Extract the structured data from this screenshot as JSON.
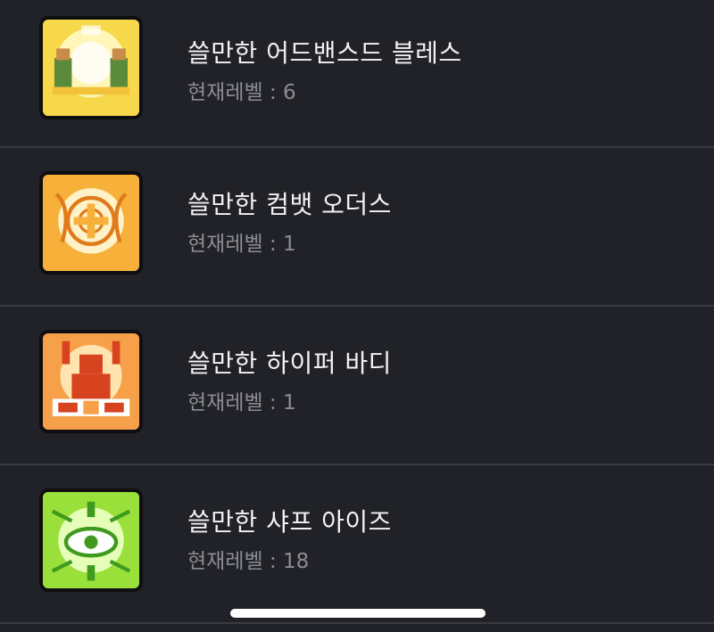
{
  "skills": [
    {
      "name": "쓸만한 어드밴스드 블레스",
      "level": "현재레벨 : 6",
      "icon": "advanced-bless-icon",
      "colors": {
        "bg": "#f6d84a",
        "glow": "#fff6b8",
        "accent": "#5a8a3a"
      }
    },
    {
      "name": "쓸만한 컴뱃 오더스",
      "level": "현재레벨 : 1",
      "icon": "combat-orders-icon",
      "colors": {
        "bg": "#f7b13a",
        "glow": "#fff1c8",
        "accent": "#e07a1a"
      }
    },
    {
      "name": "쓸만한 하이퍼 바디",
      "level": "현재레벨 : 1",
      "icon": "hyper-body-icon",
      "colors": {
        "bg": "#f7a04a",
        "glow": "#ffe4b0",
        "accent": "#d8431f"
      }
    },
    {
      "name": "쓸만한 샤프 아이즈",
      "level": "현재레벨 : 18",
      "icon": "sharp-eyes-icon",
      "colors": {
        "bg": "#9ae03a",
        "glow": "#e6ffb8",
        "accent": "#3f9a1e"
      }
    }
  ]
}
